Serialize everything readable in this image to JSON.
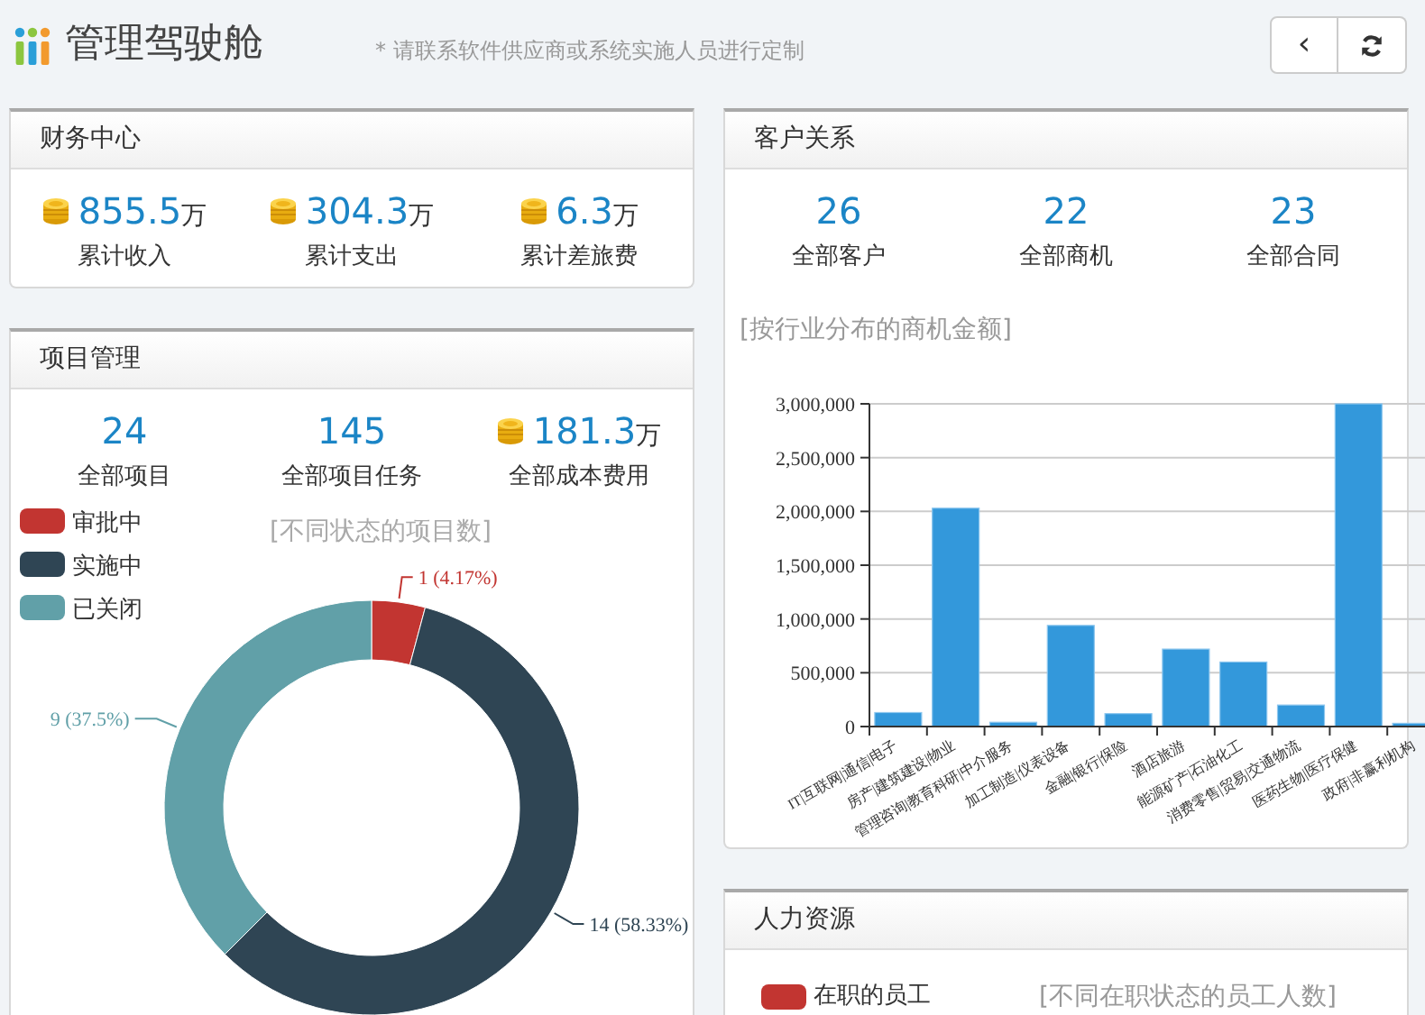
{
  "header": {
    "title": "管理驾驶舱",
    "note": "* 请联系软件供应商或系统实施人员进行定制",
    "buttons": [
      {
        "kind": "back",
        "label": "‹"
      },
      {
        "kind": "refresh"
      }
    ]
  },
  "finance": {
    "title": "财务中心",
    "stats": [
      {
        "value": "855.5",
        "unit": "万",
        "label": "累计收入",
        "coin": true
      },
      {
        "value": "304.3",
        "unit": "万",
        "label": "累计支出",
        "coin": true
      },
      {
        "value": "6.3",
        "unit": "万",
        "label": "累计差旅费",
        "coin": true
      }
    ]
  },
  "projects": {
    "title": "项目管理",
    "stats": [
      {
        "value": "24",
        "label": "全部项目",
        "coin": false
      },
      {
        "value": "145",
        "label": "全部项目任务",
        "coin": false
      },
      {
        "value": "181.3",
        "unit": "万",
        "label": "全部成本费用",
        "coin": true
      }
    ],
    "chart_data": {
      "type": "donut",
      "legend": "top-left",
      "title": "[不同状态的项目数]",
      "categories": [
        "审批中",
        "实施中",
        "已关闭"
      ],
      "values": [
        1,
        14,
        9
      ],
      "colors": [
        "#c23531",
        "#2f4554",
        "#61a0a8"
      ],
      "value_labels": [
        "1 (4.17%)",
        "14 (58.33%)",
        "9 (37.5%)"
      ]
    }
  },
  "customers": {
    "title": "客户关系",
    "stats": [
      {
        "value": "26",
        "label": "全部客户",
        "coin": false
      },
      {
        "value": "22",
        "label": "全部商机",
        "coin": false
      },
      {
        "value": "23",
        "label": "全部合同",
        "coin": false
      }
    ],
    "chart_data": {
      "type": "bar",
      "title": "[按行业分布的商机金额]",
      "categories": [
        "IT|互联网|通信|电子",
        "房产|建筑建设|物业",
        "管理咨询|教育科研|中介服务",
        "加工制造|仪表设备",
        "金融|银行|保险",
        "酒店旅游",
        "能源矿产|石油化工",
        "消费零售|贸易|交通物流",
        "医药生物|医疗保健",
        "政府|非赢利机构"
      ],
      "grid": true,
      "series": [
        {
          "color": "#3398db",
          "values": [
            130000,
            2030000,
            40000,
            940000,
            120000,
            720000,
            600000,
            200000,
            3000000,
            30000
          ]
        }
      ],
      "ylim": [
        0,
        3000000
      ],
      "yticks": [
        {
          "value": 0,
          "label": "0"
        },
        {
          "value": 500000,
          "label": "500,000"
        },
        {
          "value": 1000000,
          "label": "1,000,000"
        },
        {
          "value": 1500000,
          "label": "1,500,000"
        },
        {
          "value": 2000000,
          "label": "2,000,000"
        },
        {
          "value": 2500000,
          "label": "2,500,000"
        },
        {
          "value": 3000000,
          "label": "3,000,000"
        }
      ]
    }
  },
  "hr": {
    "title": "人力资源",
    "legend": [
      {
        "label": "在职的员工",
        "color": "#c23531"
      }
    ],
    "chart_title": "[不同在职状态的员工人数]"
  }
}
